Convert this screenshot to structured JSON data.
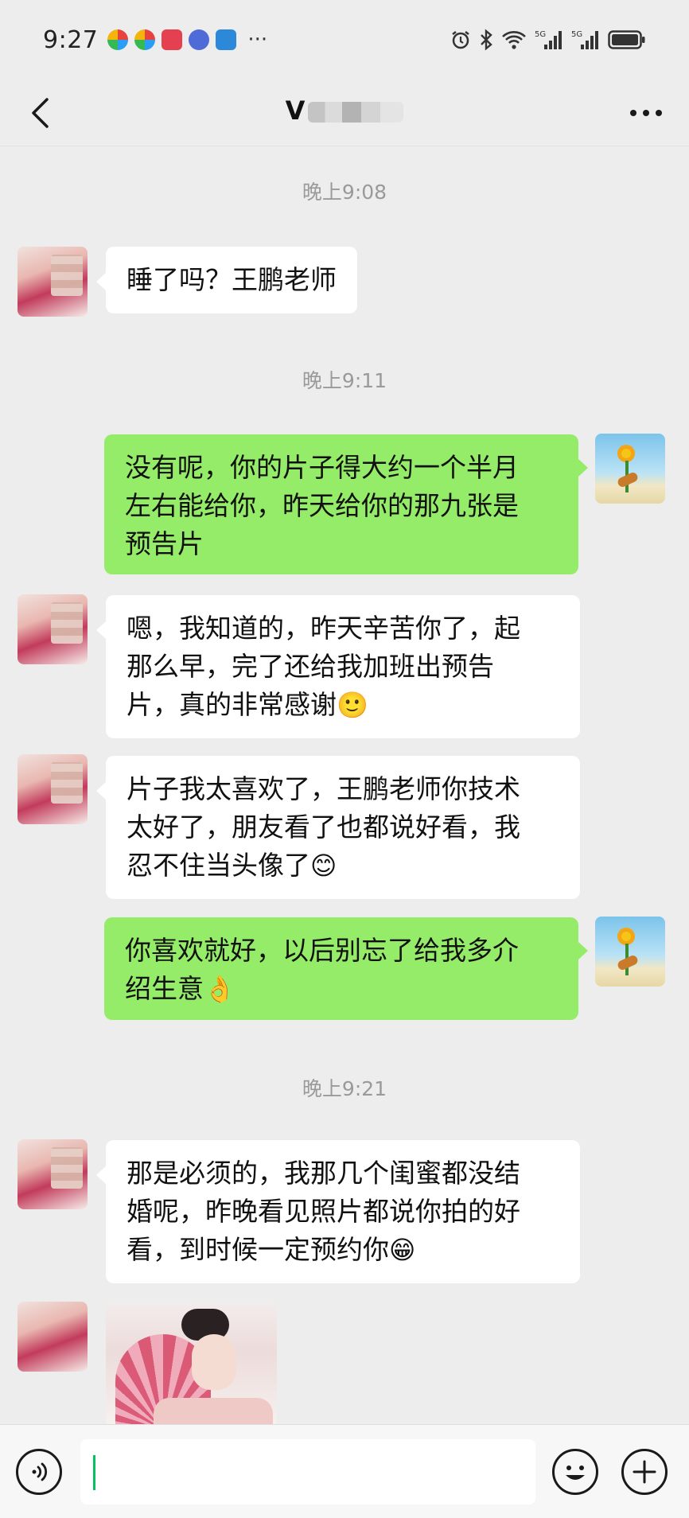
{
  "status_bar": {
    "time": "9:27",
    "more": "···",
    "app_icons": [
      "app-icon",
      "app-icon",
      "app-icon",
      "music-icon",
      "camera-icon"
    ],
    "right_icons": [
      "alarm-icon",
      "bluetooth-icon",
      "wifi-icon",
      "signal-5g-icon",
      "signal-5g-icon",
      "battery-icon"
    ]
  },
  "header": {
    "title_visible": "V",
    "back_icon": "chevron-left-icon",
    "more_icon": "more-dots-icon"
  },
  "messages": [
    {
      "type": "timestamp",
      "text": "晚上9:08"
    },
    {
      "type": "text",
      "side": "left",
      "text": "睡了吗？王鹏老师"
    },
    {
      "type": "timestamp",
      "text": "晚上9:11"
    },
    {
      "type": "text",
      "side": "right",
      "lines": [
        "没有呢，你的片子得大约一个半月",
        "左右能给你，昨天给你的那九张是",
        "预告片"
      ]
    },
    {
      "type": "text",
      "side": "left",
      "lines": [
        "嗯，我知道的，昨天辛苦你了，起",
        "那么早，完了还给我加班出预告",
        "片，真的非常感谢"
      ],
      "emoji": "🙂"
    },
    {
      "type": "text",
      "side": "left",
      "lines": [
        "片子我太喜欢了，王鹏老师你技术",
        "太好了，朋友看了也都说好看，我",
        "忍不住当头像了"
      ],
      "emoji": "😊"
    },
    {
      "type": "text",
      "side": "right",
      "lines": [
        "你喜欢就好，以后别忘了给我多介",
        "绍生意"
      ],
      "emoji": "👌"
    },
    {
      "type": "timestamp",
      "text": "晚上9:21"
    },
    {
      "type": "text",
      "side": "left",
      "lines": [
        "那是必须的，我那几个闺蜜都没结",
        "婚呢，昨晚看见照片都说你拍的好",
        "看，到时候一定预约你"
      ],
      "emoji": "😁"
    },
    {
      "type": "image",
      "side": "left",
      "description_icon": "photo-message"
    }
  ],
  "input_bar": {
    "voice_icon": "voice-icon",
    "emoji_icon": "emoji-icon",
    "plus_icon": "plus-icon",
    "value": "",
    "accent": "#07c160"
  },
  "colors": {
    "background": "#ededed",
    "my_bubble": "#95ec69",
    "their_bubble": "#ffffff",
    "timestamp": "#9a9a9a"
  }
}
